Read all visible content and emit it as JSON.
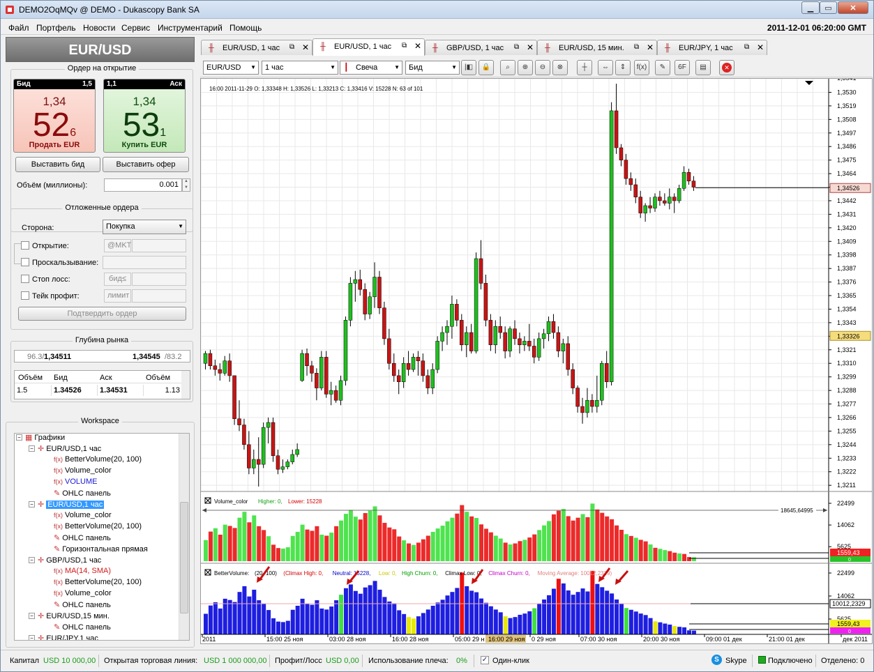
{
  "window": {
    "title": "DEMO2OqMQv @ DEMO - Dukascopy Bank SA"
  },
  "menu": {
    "items": [
      "Файл",
      "Портфель",
      "Новости",
      "Сервис",
      "Инструментарий",
      "Помощь"
    ],
    "clock": "2011-12-01 06:20:00 GMT"
  },
  "instrument": "EUR/USD",
  "order_panel": {
    "title": "Ордер на открытие",
    "bid": {
      "label": "Бид",
      "size": "1,5",
      "prefix": "1,34",
      "big": "52",
      "pip": "6",
      "action": "Продать EUR"
    },
    "ask": {
      "label": "Аск",
      "size": "1,1",
      "prefix": "1,34",
      "big": "53",
      "pip": "1",
      "action": "Купить EUR"
    },
    "place_bid": "Выставить бид",
    "place_offer": "Выставить офер",
    "volume_label": "Объём (миллионы):",
    "volume_value": "0.001"
  },
  "pending": {
    "title": "Отложенные ордера",
    "side_label": "Сторона:",
    "side_value": "Покупка",
    "open_label": "Открытие:",
    "open_tag": "@MKT",
    "slippage_label": "Проскальзывание:",
    "stoploss_label": "Стоп лосс:",
    "stoploss_tag": "бид≤",
    "takeprofit_label": "Тейк профит:",
    "takeprofit_tag": "лимит",
    "confirm": "Подтвердить ордер"
  },
  "depth": {
    "title": "Глубина рынка",
    "bid_vol": "96.3/",
    "bid_price": "1,34511",
    "ask_price": "1,34545",
    "ask_vol": "/83.2",
    "headers": [
      "Объём",
      "Бид",
      "Аск",
      "Объём"
    ],
    "row": [
      "1.5",
      "1.34526",
      "1.34531",
      "1.13"
    ]
  },
  "workspace": {
    "title": "Workspace",
    "items": [
      {
        "text": "Графики",
        "icon": "folder"
      },
      {
        "text": "EUR/USD,1 час",
        "icon": "chart"
      },
      {
        "text": "BetterVolume(20, 100)",
        "icon": "fx"
      },
      {
        "text": "Volume_color",
        "icon": "fx"
      },
      {
        "text": "VOLUME",
        "icon": "fx",
        "color": "#1a1ad4"
      },
      {
        "text": "OHLC панель",
        "icon": "draw"
      },
      {
        "text": "EUR/USD,1 час",
        "icon": "chart",
        "selected": true
      },
      {
        "text": "Volume_color",
        "icon": "fx"
      },
      {
        "text": "BetterVolume(20, 100)",
        "icon": "fx"
      },
      {
        "text": "OHLC панель",
        "icon": "draw"
      },
      {
        "text": "Горизонтальная прямая",
        "icon": "draw"
      },
      {
        "text": "GBP/USD,1 час",
        "icon": "chart"
      },
      {
        "text": "MA(14, SMA)",
        "icon": "fx",
        "color": "#d41a1a"
      },
      {
        "text": "BetterVolume(20, 100)",
        "icon": "fx"
      },
      {
        "text": "Volume_color",
        "icon": "fx"
      },
      {
        "text": "OHLC панель",
        "icon": "draw"
      },
      {
        "text": "EUR/USD,15 мин.",
        "icon": "chart"
      },
      {
        "text": "OHLC панель",
        "icon": "draw"
      },
      {
        "text": "EUR/JPY,1 час",
        "icon": "chart"
      }
    ]
  },
  "tabs": [
    {
      "label": "EUR/USD, 1 час"
    },
    {
      "label": "EUR/USD, 1 час",
      "active": true
    },
    {
      "label": "GBP/USD, 1 час"
    },
    {
      "label": "EUR/USD, 15 мин."
    },
    {
      "label": "EUR/JPY, 1 час"
    }
  ],
  "toolbar": {
    "instrument": "EUR/USD",
    "period": "1 час",
    "type": "Свеча",
    "side": "Бид"
  },
  "ohlc_info": "16:00 2011-11-29  O: 1,33348  H: 1,33526  L: 1,33213  C: 1,33416  V: 15228  N: 63 of 101",
  "price_axis": {
    "ticks": [
      "1,3530",
      "1,3519",
      "1,3508",
      "1,3497",
      "1,3486",
      "1,3475",
      "1,3464",
      "1,3453",
      "1,3442",
      "1,3431",
      "1,3420",
      "1,3409",
      "1,3398",
      "1,3387",
      "1,3376",
      "1,3365",
      "1,3354",
      "1,3343",
      "1,3332",
      "1,3321",
      "1,3310",
      "1,3299",
      "1,3288",
      "1,3277",
      "1,3266",
      "1,3255",
      "1,3244",
      "1,3233",
      "1,3222",
      "1,3211"
    ],
    "current": "1,34526",
    "marker": "1,33326",
    "top_partial": "1,3541"
  },
  "volume_panel": {
    "title": "Volume_color",
    "higher": "Higher: 0,",
    "lower": "Lower: 15228",
    "line_label": "18645,64995",
    "ticks": [
      "22499",
      "14062",
      "5625"
    ],
    "box1": "1559,43",
    "box2": "0"
  },
  "bv_panel": {
    "title_parts": [
      {
        "t": "BetterVolume:",
        "c": "#000"
      },
      {
        "t": "(20, 100)",
        "c": "#000"
      },
      {
        "t": "(Climax High: 0,",
        "c": "#d40000"
      },
      {
        "t": "Neutral: 15228,",
        "c": "#0000c8"
      },
      {
        "t": "Low: 0,",
        "c": "#c8c800"
      },
      {
        "t": "High Churn: 0,",
        "c": "#00a000"
      },
      {
        "t": "Climax Low: 0,",
        "c": "#000"
      },
      {
        "t": "Climax Churn: 0,",
        "c": "#c000c0"
      },
      {
        "t": "Moving Average: 10012,2329)",
        "c": "#e08080"
      }
    ],
    "ticks": [
      "22499",
      "14062",
      "5625"
    ],
    "ma_box": "10012,2329",
    "box1": "1559,43",
    "box2": "0"
  },
  "time_axis": {
    "labels": [
      {
        "t": "2011",
        "hl": false
      },
      {
        "t": "15:00 25 ноя",
        "hl": false
      },
      {
        "t": "03:00 28 ноя",
        "hl": false
      },
      {
        "t": "16:00 28 ноя",
        "hl": false
      },
      {
        "t": "05:00 29 н",
        "hl": false
      },
      {
        "t": "16:00 29 ноя",
        "hl": true
      },
      {
        "t": "0 29 ноя",
        "hl": false
      },
      {
        "t": "07:00 30 ноя",
        "hl": false
      },
      {
        "t": "20:00 30 ноя",
        "hl": false
      },
      {
        "t": "09:00 01 дек",
        "hl": false
      },
      {
        "t": "21:00 01 дек",
        "hl": false
      },
      {
        "t": "дек 2011",
        "hl": false
      }
    ]
  },
  "status": {
    "capital_label": "Капитал",
    "capital_value": "USD 10 000,00",
    "open_line_label": "Открытая торговая линия:",
    "open_line_value": "USD 1 000 000,00",
    "pl_label": "Профит/Лосс",
    "pl_value": "USD 0,00",
    "leverage_label": "Использование плеча:",
    "leverage_value": "0%",
    "oneclick": "Один-клик",
    "skype": "Skype",
    "connected": "Подключено",
    "detached": "Отделено: 0"
  },
  "colors": {
    "up": "#1fbf1f",
    "down": "#c81414",
    "neutral": "#1e1ee0",
    "low": "#e6e600",
    "bg": "#ffffff"
  },
  "chart_data": {
    "type": "candlestick",
    "title": "",
    "ylim": [
      1.3206,
      1.3541
    ],
    "candles": [
      [
        1.331,
        1.332,
        1.3305,
        1.3318
      ],
      [
        1.3318,
        1.3321,
        1.3305,
        1.3308
      ],
      [
        1.3308,
        1.3313,
        1.33,
        1.3305
      ],
      [
        1.3305,
        1.331,
        1.3296,
        1.3302
      ],
      [
        1.3302,
        1.3316,
        1.33,
        1.3312
      ],
      [
        1.3312,
        1.3318,
        1.3295,
        1.33
      ],
      [
        1.33,
        1.33,
        1.326,
        1.3265
      ],
      [
        1.3265,
        1.328,
        1.3255,
        1.326
      ],
      [
        1.326,
        1.3265,
        1.324,
        1.3244
      ],
      [
        1.3244,
        1.3255,
        1.322,
        1.3225
      ],
      [
        1.3225,
        1.324,
        1.322,
        1.3232
      ],
      [
        1.3232,
        1.325,
        1.321,
        1.3228
      ],
      [
        1.3228,
        1.3262,
        1.3225,
        1.3258
      ],
      [
        1.3258,
        1.3266,
        1.3245,
        1.3262
      ],
      [
        1.3262,
        1.3266,
        1.323,
        1.3235
      ],
      [
        1.3235,
        1.324,
        1.322,
        1.3224
      ],
      [
        1.3224,
        1.3232,
        1.3221,
        1.3226
      ],
      [
        1.3226,
        1.3232,
        1.3224,
        1.323
      ],
      [
        1.323,
        1.324,
        1.3228,
        1.3236
      ],
      [
        1.3236,
        1.3245,
        1.3234,
        1.324
      ],
      [
        1.3296,
        1.3321,
        1.3295,
        1.3318
      ],
      [
        1.3318,
        1.3322,
        1.33,
        1.3308
      ],
      [
        1.3308,
        1.3312,
        1.3295,
        1.3302
      ],
      [
        1.3302,
        1.3306,
        1.328,
        1.329
      ],
      [
        1.329,
        1.332,
        1.3288,
        1.3315
      ],
      [
        1.3315,
        1.332,
        1.3282,
        1.3285
      ],
      [
        1.3285,
        1.3295,
        1.3276,
        1.3288
      ],
      [
        1.3288,
        1.3292,
        1.3278,
        1.328
      ],
      [
        1.328,
        1.33,
        1.3276,
        1.3296
      ],
      [
        1.3296,
        1.3348,
        1.3292,
        1.3345
      ],
      [
        1.3345,
        1.338,
        1.334,
        1.3375
      ],
      [
        1.3375,
        1.3385,
        1.336,
        1.3378
      ],
      [
        1.3378,
        1.3386,
        1.3365,
        1.337
      ],
      [
        1.337,
        1.3375,
        1.3345,
        1.335
      ],
      [
        1.335,
        1.3368,
        1.3346,
        1.3364
      ],
      [
        1.3364,
        1.3392,
        1.3355,
        1.338
      ],
      [
        1.338,
        1.3385,
        1.335,
        1.3355
      ],
      [
        1.3355,
        1.336,
        1.3325,
        1.333
      ],
      [
        1.333,
        1.3338,
        1.3305,
        1.331
      ],
      [
        1.331,
        1.3318,
        1.3295,
        1.33
      ],
      [
        1.33,
        1.3305,
        1.3285,
        1.3295
      ],
      [
        1.3295,
        1.3315,
        1.329,
        1.331
      ],
      [
        1.331,
        1.332,
        1.33,
        1.3305
      ],
      [
        1.3305,
        1.3318,
        1.3303,
        1.3315
      ],
      [
        1.3315,
        1.332,
        1.33,
        1.3312
      ],
      [
        1.3312,
        1.3318,
        1.3295,
        1.33
      ],
      [
        1.33,
        1.3305,
        1.3285,
        1.329
      ],
      [
        1.329,
        1.331,
        1.3285,
        1.3305
      ],
      [
        1.3305,
        1.3332,
        1.3302,
        1.3328
      ],
      [
        1.3328,
        1.334,
        1.332,
        1.3335
      ],
      [
        1.3335,
        1.3345,
        1.3325,
        1.334
      ],
      [
        1.334,
        1.3365,
        1.333,
        1.3358
      ],
      [
        1.3358,
        1.3362,
        1.334,
        1.3345
      ],
      [
        1.3345,
        1.335,
        1.332,
        1.3325
      ],
      [
        1.3325,
        1.334,
        1.3315,
        1.3335
      ],
      [
        1.3335,
        1.3342,
        1.3318,
        1.332
      ],
      [
        1.332,
        1.34,
        1.3318,
        1.3395
      ],
      [
        1.3395,
        1.341,
        1.337,
        1.3375
      ],
      [
        1.3375,
        1.3382,
        1.334,
        1.3345
      ],
      [
        1.3345,
        1.335,
        1.332,
        1.3325
      ],
      [
        1.3325,
        1.3345,
        1.3318,
        1.334
      ],
      [
        1.334,
        1.3348,
        1.333,
        1.3335
      ],
      [
        1.3335,
        1.334,
        1.3314,
        1.332
      ],
      [
        1.332,
        1.334,
        1.3315,
        1.3338
      ],
      [
        1.3338,
        1.3345,
        1.3325,
        1.333
      ],
      [
        1.333,
        1.3335,
        1.3318,
        1.3325
      ],
      [
        1.3325,
        1.3332,
        1.332,
        1.3328
      ],
      [
        1.3328,
        1.3342,
        1.332,
        1.3324
      ],
      [
        1.3324,
        1.333,
        1.331,
        1.3315
      ],
      [
        1.3315,
        1.3335,
        1.3312,
        1.333
      ],
      [
        1.333,
        1.3338,
        1.3322,
        1.3334
      ],
      [
        1.3334,
        1.3348,
        1.3328,
        1.3344
      ],
      [
        1.3344,
        1.335,
        1.333,
        1.3335
      ],
      [
        1.3335,
        1.334,
        1.3315,
        1.332
      ],
      [
        1.332,
        1.333,
        1.331,
        1.3326
      ],
      [
        1.3326,
        1.3332,
        1.33,
        1.3305
      ],
      [
        1.3305,
        1.331,
        1.3285,
        1.329
      ],
      [
        1.329,
        1.3292,
        1.327,
        1.3275
      ],
      [
        1.3275,
        1.3282,
        1.3261,
        1.327
      ],
      [
        1.327,
        1.329,
        1.3266,
        1.328
      ],
      [
        1.328,
        1.3285,
        1.327,
        1.3275
      ],
      [
        1.3275,
        1.33,
        1.327,
        1.328
      ],
      [
        1.328,
        1.3312,
        1.3276,
        1.331
      ],
      [
        1.331,
        1.332,
        1.329,
        1.3295
      ],
      [
        1.3295,
        1.3522,
        1.3292,
        1.3515
      ],
      [
        1.3515,
        1.3537,
        1.348,
        1.3485
      ],
      [
        1.3485,
        1.3488,
        1.347,
        1.3475
      ],
      [
        1.3475,
        1.348,
        1.3455,
        1.346
      ],
      [
        1.346,
        1.3465,
        1.345,
        1.3455
      ],
      [
        1.3455,
        1.346,
        1.344,
        1.3445
      ],
      [
        1.3445,
        1.345,
        1.3428,
        1.3432
      ],
      [
        1.3432,
        1.344,
        1.3425,
        1.3438
      ],
      [
        1.3438,
        1.3445,
        1.3432,
        1.3436
      ],
      [
        1.3436,
        1.3448,
        1.3433,
        1.3445
      ],
      [
        1.3445,
        1.345,
        1.3438,
        1.3442
      ],
      [
        1.3442,
        1.3448,
        1.3438,
        1.344
      ],
      [
        1.344,
        1.3452,
        1.3435,
        1.3445
      ],
      [
        1.3445,
        1.3448,
        1.3432,
        1.3442
      ],
      [
        1.3442,
        1.3455,
        1.344,
        1.3452
      ],
      [
        1.3452,
        1.347,
        1.345,
        1.3465
      ],
      [
        1.3465,
        1.3468,
        1.3455,
        1.3458
      ],
      [
        1.3458,
        1.3462,
        1.345,
        1.3453
      ]
    ],
    "volume": [
      8200,
      11500,
      12800,
      10300,
      14200,
      13700,
      12900,
      16900,
      19200,
      15100,
      17800,
      13600,
      12100,
      9700,
      6400,
      5100,
      4900,
      5400,
      9800,
      11400,
      14200,
      12300,
      11800,
      13600,
      10300,
      9900,
      11100,
      13600,
      15800,
      18400,
      19900,
      17300,
      16200,
      18700,
      19600,
      21300,
      17800,
      14900,
      13100,
      12400,
      9600,
      8100,
      6900,
      6300,
      7200,
      8500,
      9900,
      11400,
      12700,
      13800,
      15500,
      16900,
      18500,
      21800,
      19200,
      17400,
      16800,
      14300,
      12600,
      11200,
      9900,
      8800,
      7200,
      6500,
      6900,
      7800,
      8300,
      9200,
      10400,
      12100,
      13900,
      15600,
      18200,
      19600,
      20300,
      17500,
      15800,
      16900,
      18300,
      17100,
      22400,
      20100,
      18800,
      17400,
      16300,
      13900,
      12200,
      10500,
      9800,
      9100,
      8300,
      7700,
      6500,
      5200,
      4800,
      4300,
      3900,
      3300,
      3000,
      2800,
      1600,
      1500
    ],
    "volume_up": [
      true,
      false,
      true,
      false,
      true,
      false,
      false,
      true,
      true,
      false,
      true,
      false,
      false,
      true,
      false,
      false,
      true,
      true,
      true,
      true,
      true,
      false,
      false,
      false,
      true,
      false,
      true,
      false,
      true,
      true,
      true,
      true,
      false,
      false,
      true,
      true,
      false,
      false,
      false,
      false,
      false,
      true,
      false,
      true,
      false,
      false,
      false,
      true,
      true,
      true,
      true,
      true,
      false,
      false,
      true,
      false,
      true,
      false,
      false,
      false,
      true,
      true,
      false,
      true,
      false,
      false,
      true,
      false,
      false,
      true,
      true,
      true,
      false,
      false,
      true,
      false,
      false,
      false,
      true,
      false,
      true,
      false,
      false,
      false,
      false,
      false,
      false,
      true,
      false,
      true,
      false,
      false,
      true,
      false,
      true,
      true,
      false,
      false,
      true,
      false,
      false,
      true
    ],
    "bv_class": [
      "n",
      "n",
      "n",
      "n",
      "n",
      "n",
      "n",
      "n",
      "n",
      "n",
      "n",
      "n",
      "n",
      "n",
      "n",
      "n",
      "n",
      "n",
      "n",
      "n",
      "n",
      "n",
      "n",
      "n",
      "n",
      "n",
      "n",
      "n",
      "h",
      "n",
      "n",
      "n",
      "n",
      "n",
      "n",
      "n",
      "n",
      "n",
      "n",
      "n",
      "n",
      "n",
      "l",
      "l",
      "n",
      "n",
      "n",
      "n",
      "n",
      "n",
      "n",
      "n",
      "n",
      "c",
      "n",
      "n",
      "n",
      "n",
      "n",
      "n",
      "n",
      "n",
      "l",
      "n",
      "n",
      "n",
      "n",
      "n",
      "h",
      "n",
      "n",
      "n",
      "n",
      "c",
      "n",
      "n",
      "n",
      "n",
      "n",
      "n",
      "c",
      "n",
      "n",
      "n",
      "n",
      "n",
      "n",
      "h",
      "n",
      "n",
      "n",
      "n",
      "n",
      "l",
      "n",
      "n",
      "n",
      "l",
      "n",
      "n",
      "n",
      "n"
    ]
  }
}
